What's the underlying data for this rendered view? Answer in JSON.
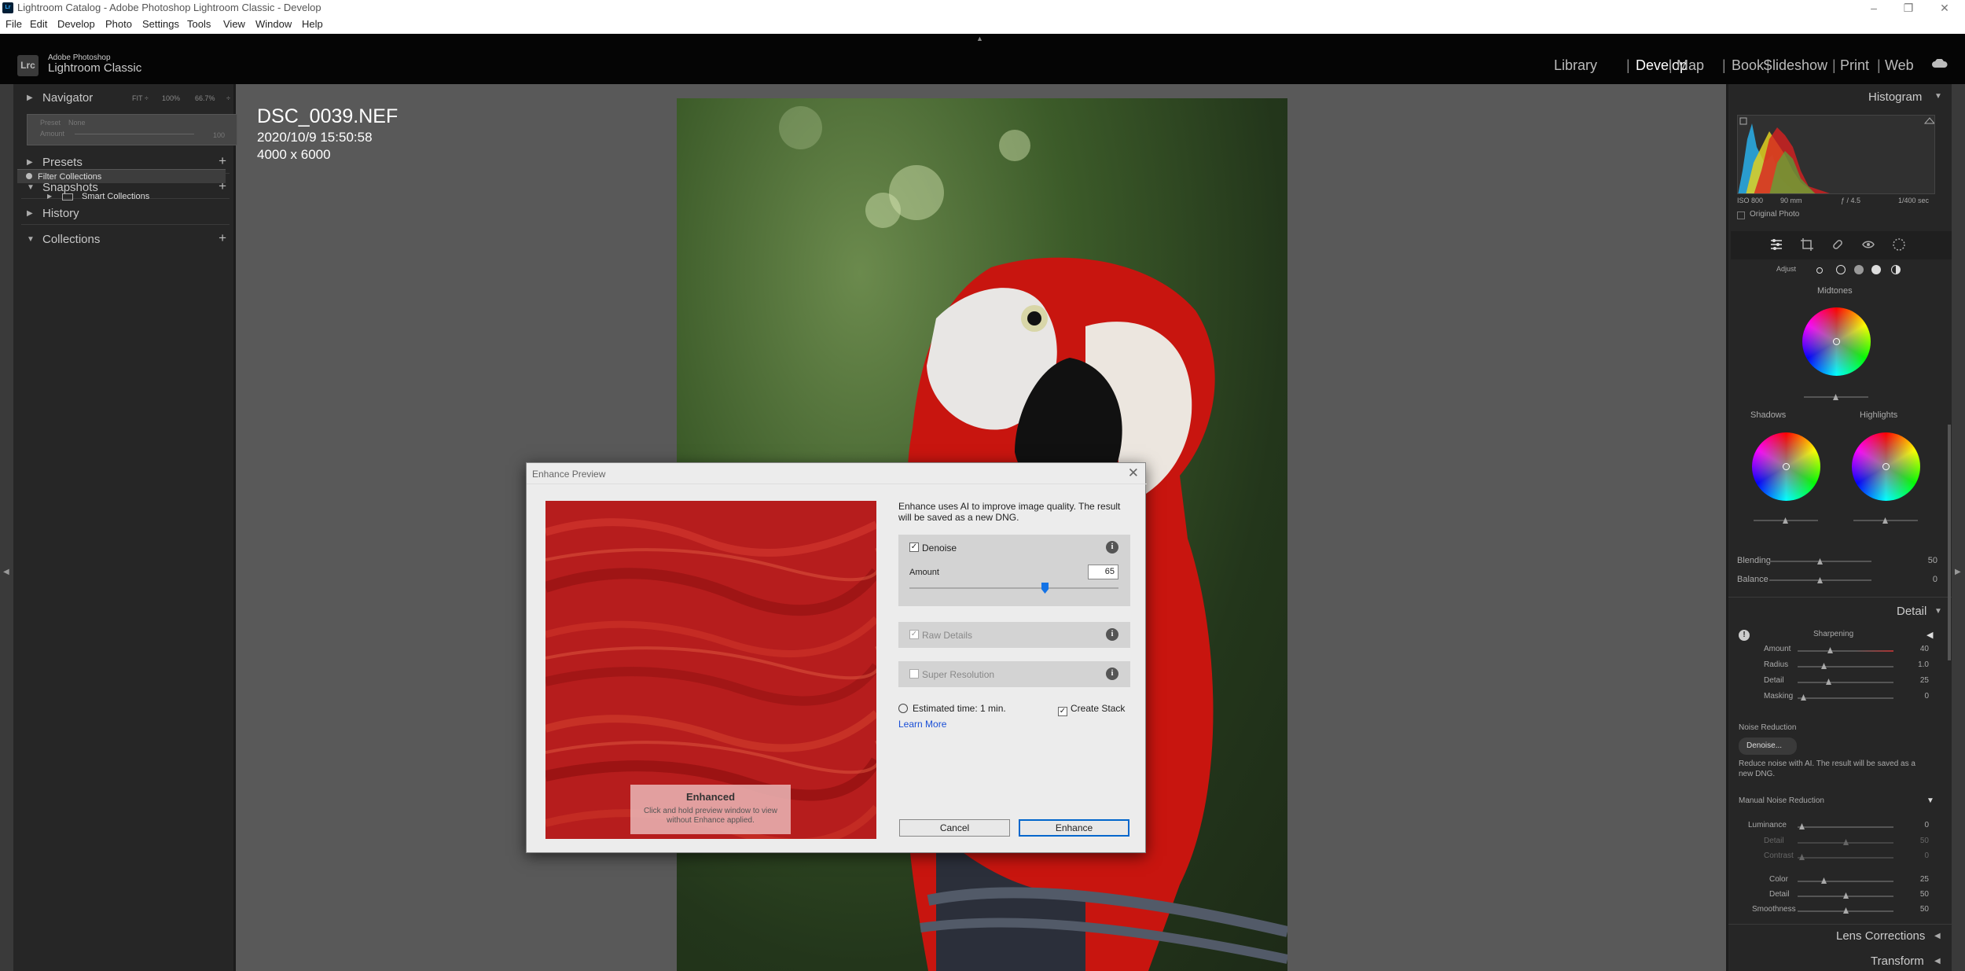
{
  "window": {
    "title": "Lightroom Catalog - Adobe Photoshop Lightroom Classic - Develop"
  },
  "menu": [
    "File",
    "Edit",
    "Develop",
    "Photo",
    "Settings",
    "Tools",
    "View",
    "Window",
    "Help"
  ],
  "brand": {
    "line1": "Adobe Photoshop",
    "line2": "Lightroom Classic",
    "badge": "Lrc"
  },
  "modules": [
    {
      "label": "Library",
      "active": false
    },
    {
      "label": "Develop",
      "active": true
    },
    {
      "label": "Map",
      "active": false
    },
    {
      "label": "Book",
      "active": false
    },
    {
      "label": "Slideshow",
      "active": false
    },
    {
      "label": "Print",
      "active": false
    },
    {
      "label": "Web",
      "active": false
    }
  ],
  "left": {
    "navigator": {
      "label": "Navigator",
      "zoom": [
        "FIT ÷",
        "100%",
        "66.7%",
        "÷"
      ],
      "preset_label": "Preset",
      "preset_value": "None",
      "amount_label": "Amount",
      "amount_value": "100"
    },
    "presets": "Presets",
    "snapshots": "Snapshots",
    "history": "History",
    "collections": "Collections",
    "filter_collections": "Filter Collections",
    "smart_collections": "Smart Collections"
  },
  "photo": {
    "filename": "DSC_0039.NEF",
    "datetime": "2020/10/9 15:50:58",
    "dimensions": "4000 x 6000"
  },
  "dialog": {
    "title": "Enhance Preview",
    "description": "Enhance uses AI to improve image quality. The result will be saved as a new DNG.",
    "denoise": {
      "label": "Denoise",
      "checked": true,
      "amount_label": "Amount",
      "amount_value": "65",
      "amount_fraction": 0.65
    },
    "raw_details": {
      "label": "Raw Details",
      "checked": true,
      "disabled": true
    },
    "super_resolution": {
      "label": "Super Resolution",
      "checked": false,
      "disabled": true
    },
    "estimated_time": "Estimated time: 1 min.",
    "create_stack": {
      "label": "Create Stack",
      "checked": true
    },
    "learn_more": "Learn More",
    "cancel": "Cancel",
    "enhance": "Enhance",
    "preview_overlay_title": "Enhanced",
    "preview_overlay_text": "Click and hold preview window to view without Enhance applied.",
    "check_glyph": "✓"
  },
  "right": {
    "histogram": {
      "label": "Histogram",
      "iso": "ISO 800",
      "focal": "90 mm",
      "aperture": "ƒ / 4.5",
      "shutter": "1/400 sec",
      "original_photo": "Original Photo"
    },
    "color_grading": {
      "adjust": "Adjust",
      "midtones": "Midtones",
      "shadows": "Shadows",
      "highlights": "Highlights",
      "blending_label": "Blending",
      "blending_value": "50",
      "balance_label": "Balance",
      "balance_value": "0"
    },
    "detail": {
      "label": "Detail",
      "sharpening": "Sharpening",
      "sharpen_rows": [
        {
          "label": "Amount",
          "value": "40"
        },
        {
          "label": "Radius",
          "value": "1.0"
        },
        {
          "label": "Detail",
          "value": "25"
        },
        {
          "label": "Masking",
          "value": "0"
        }
      ],
      "noise_reduction": "Noise Reduction",
      "denoise_button": "Denoise...",
      "nr_text": "Reduce noise with AI. The result will be saved as a new DNG.",
      "manual_nr": "Manual Noise Reduction",
      "manual_rows": [
        {
          "label": "Luminance",
          "value": "0"
        },
        {
          "label": "Detail",
          "value": "50"
        },
        {
          "label": "Contrast",
          "value": "0"
        },
        {
          "label": "Color",
          "value": "25"
        },
        {
          "label": "Detail",
          "value": "50"
        },
        {
          "label": "Smoothness",
          "value": "50"
        }
      ]
    },
    "lens_corrections": "Lens Corrections",
    "transform": "Transform"
  },
  "colors": {
    "accent": "#1473e6",
    "link": "#1a4fd6",
    "panel": "#262626",
    "canvas": "#595959"
  },
  "icons": [
    "lrc-logo",
    "cloud-icon",
    "edit-sliders-icon",
    "crop-icon",
    "healing-icon",
    "red-eye-icon",
    "masking-icon",
    "info-icon",
    "zoom-icon",
    "clock-icon",
    "warning-icon"
  ]
}
